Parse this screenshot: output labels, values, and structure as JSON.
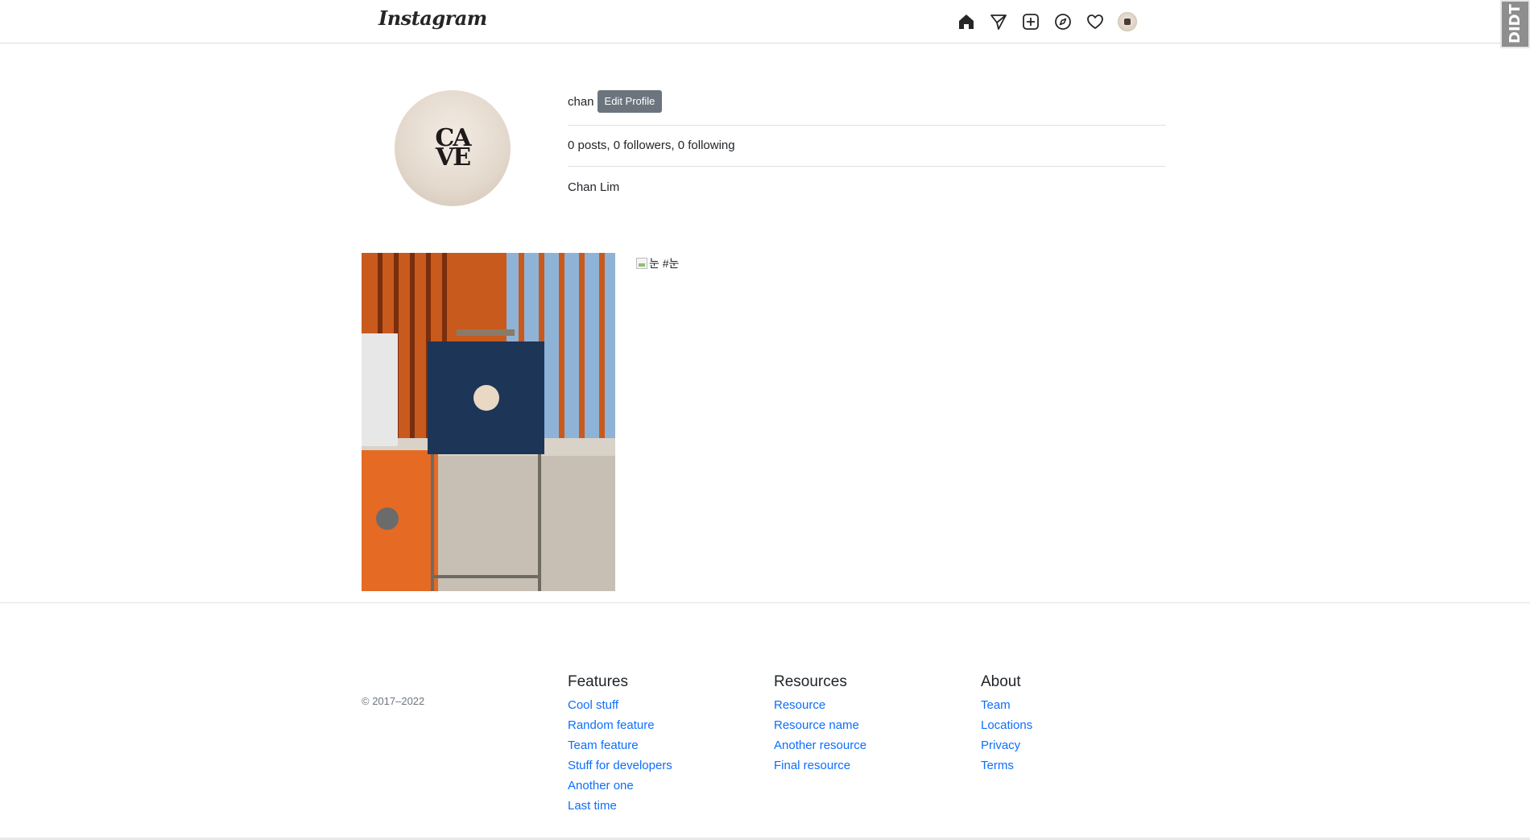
{
  "app": {
    "logo": "Instagram",
    "extension_badge": "DIDT"
  },
  "nav": {
    "icons": [
      "home-icon",
      "send-icon",
      "add-post-icon",
      "explore-icon",
      "heart-icon",
      "profile-avatar"
    ]
  },
  "profile": {
    "username": "chan",
    "edit_button": "Edit Profile",
    "stats": "0 posts, 0 followers, 0 following",
    "full_name": "Chan Lim",
    "avatar_text_line1": "CA",
    "avatar_text_line2": "VE"
  },
  "posts": {
    "broken_image_alt": "눈 #눈"
  },
  "footer": {
    "copyright": "© 2017–2022",
    "columns": [
      {
        "title": "Features",
        "links": [
          "Cool stuff",
          "Random feature",
          "Team feature",
          "Stuff for developers",
          "Another one",
          "Last time"
        ]
      },
      {
        "title": "Resources",
        "links": [
          "Resource",
          "Resource name",
          "Another resource",
          "Final resource"
        ]
      },
      {
        "title": "About",
        "links": [
          "Team",
          "Locations",
          "Privacy",
          "Terms"
        ]
      }
    ]
  },
  "colors": {
    "edit_button_bg": "#6c757d",
    "link": "#0d6efd",
    "divider": "#dee2e6"
  }
}
